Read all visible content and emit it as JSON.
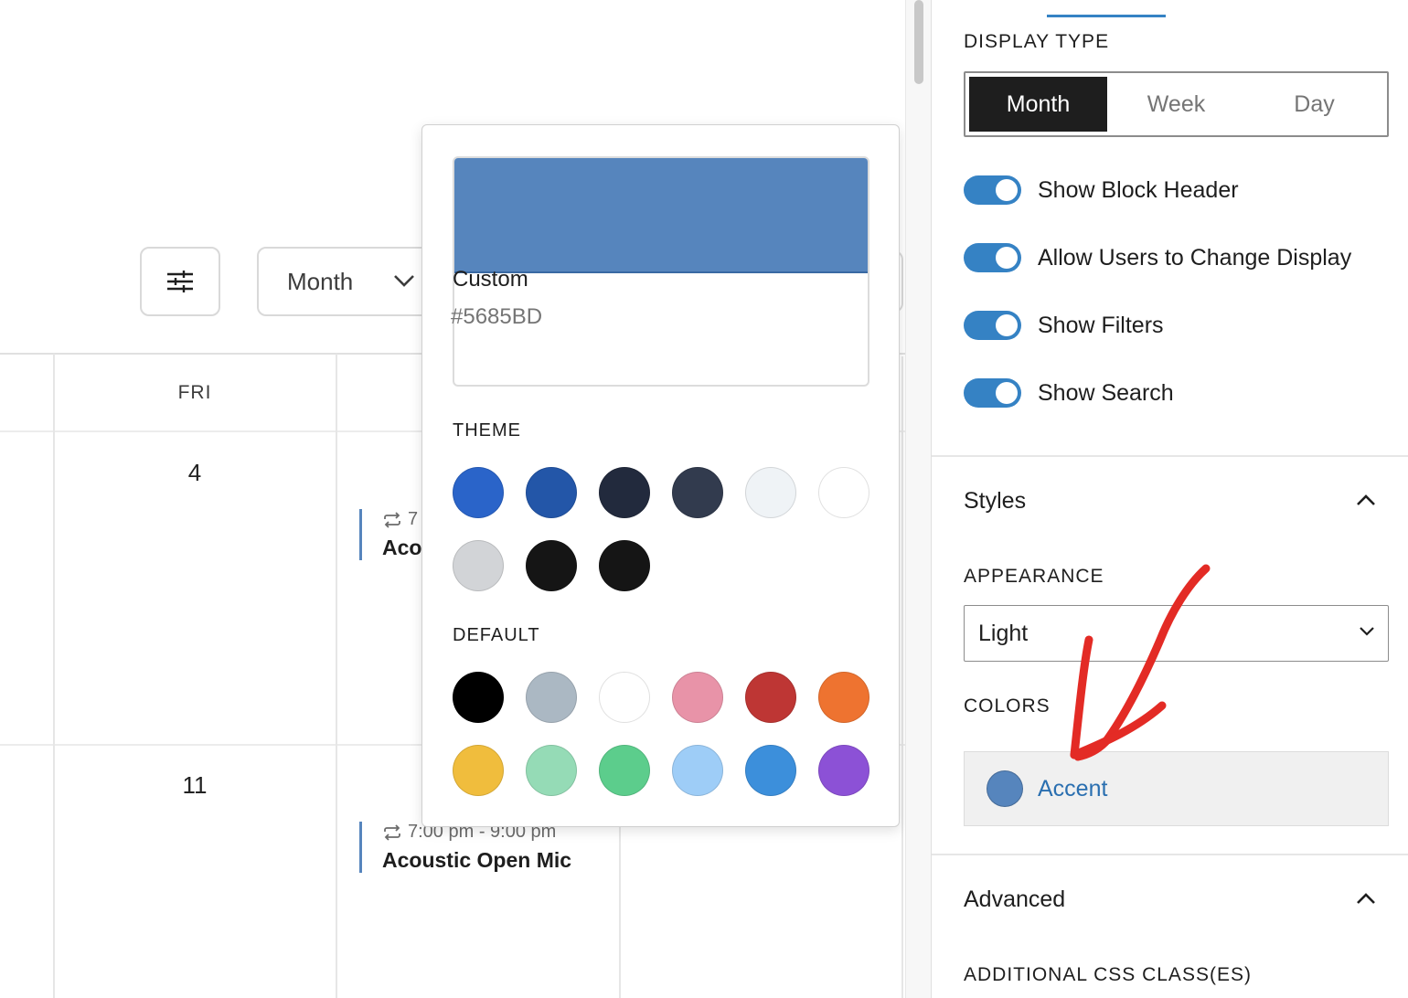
{
  "calendar": {
    "view_selector": {
      "value": "Month"
    },
    "day_headers": [
      {
        "label": "FRI"
      }
    ],
    "day_numbers": [
      "4",
      "11"
    ],
    "events": [
      {
        "time": "7",
        "title": "Aco"
      },
      {
        "time": "7:00 pm - 9:00 pm",
        "title": "Acoustic Open Mic"
      }
    ]
  },
  "color_picker": {
    "current": {
      "name": "Custom",
      "hex": "#5685BD"
    },
    "theme_heading": "THEME",
    "theme_colors": [
      "#2a64c9",
      "#2356a8",
      "#222a3d",
      "#323b4e",
      "#eff3f6",
      "#ffffff",
      "#d2d4d7",
      "#151515",
      "#151515"
    ],
    "default_heading": "DEFAULT",
    "default_colors": [
      "#000000",
      "#abb8c3",
      "#ffffff",
      "#e893a8",
      "#be3634",
      "#ee7330",
      "#f0bd3d",
      "#95dbb6",
      "#5ccd8c",
      "#9ecdf7",
      "#3c8fdb",
      "#8c51d6"
    ]
  },
  "sidebar": {
    "display_type": {
      "label": "DISPLAY TYPE",
      "options": [
        "Month",
        "Week",
        "Day"
      ],
      "selected": "Month"
    },
    "toggles": [
      {
        "label": "Show Block Header",
        "on": true
      },
      {
        "label": "Allow Users to Change Display",
        "on": true
      },
      {
        "label": "Show Filters",
        "on": true
      },
      {
        "label": "Show Search",
        "on": true
      }
    ],
    "styles": {
      "title": "Styles",
      "appearance_label": "APPEARANCE",
      "appearance_value": "Light",
      "colors_label": "COLORS",
      "accent_label": "Accent",
      "accent_color": "#5685BD"
    },
    "advanced": {
      "title": "Advanced",
      "css_label": "ADDITIONAL CSS CLASS(ES)"
    }
  },
  "colors": {
    "toggle_on": "#3582c4",
    "annotation_arrow": "#e32b25"
  }
}
